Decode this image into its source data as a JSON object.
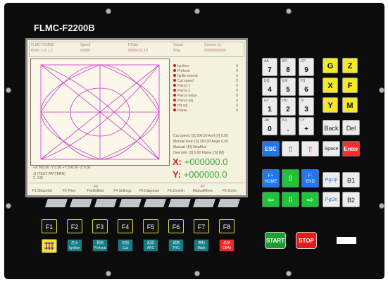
{
  "brand": "FLMC-F2200B",
  "screen": {
    "header": [
      {
        "title": "FLMC F2200B",
        "value": "Ratio: 1.3, 1.1"
      },
      {
        "title": "Speed",
        "value": "00000"
      },
      {
        "title": "F.Rate",
        "value": "50000.01.10"
      },
      {
        "title": "Status",
        "value": "Stop"
      },
      {
        "title": "Current no.",
        "value": "00000000000"
      }
    ],
    "params": [
      {
        "label": "Ignition",
        "value": "0"
      },
      {
        "label": "Preheat",
        "value": "0"
      },
      {
        "label": "Ignite extend",
        "value": "0"
      },
      {
        "label": "Cut speed",
        "value": "0"
      },
      {
        "label": "Pierce 1",
        "value": "0"
      },
      {
        "label": "Pierce 2",
        "value": "0"
      },
      {
        "label": "Pierce delay",
        "value": "0"
      },
      {
        "label": "Pierce adj",
        "value": "0"
      },
      {
        "label": "Hit adj",
        "value": "0"
      },
      {
        "label": "Flame",
        "value": "0"
      }
    ],
    "status_lines": [
      "Cut speed: [S] 300.00 Kerf [V] 0.00",
      "Manual feed: [S] 300.00 Angle 0.00",
      "Manual: [M] StepMov",
      "Override: [S] 5.00 Flame: [S] [M]"
    ],
    "coords": "+X:500.00    -Y:0.00    +Y:500.00    -Z:0.00",
    "program": [
      "1) (TEST PATTERN)",
      "2. 100"
    ],
    "x_label": "X:",
    "x_value": "+000000.0",
    "y_label": "Y:",
    "y_value": "+000000.0",
    "fbar": [
      {
        "top": "",
        "bottom": "F1 ShapeLib"
      },
      {
        "top": "",
        "bottom": "F2 Files"
      },
      {
        "top": "F3",
        "bottom": "PartEdition"
      },
      {
        "top": "",
        "bottom": "F4 Settings"
      },
      {
        "top": "",
        "bottom": "F5 Diagnose"
      },
      {
        "top": "",
        "bottom": "F6 ZoomIn"
      },
      {
        "top": "F7",
        "bottom": "ManualMove"
      },
      {
        "top": "",
        "bottom": "F8 Zoom"
      }
    ]
  },
  "fkeys": [
    "F1",
    "F2",
    "F3",
    "F4",
    "F5",
    "F6",
    "F7",
    "F8"
  ],
  "tkeys": [
    {
      "zh": "",
      "en": ""
    },
    {
      "zh": "左火",
      "en": "Ignition"
    },
    {
      "zh": "预热",
      "en": "Preheat"
    },
    {
      "zh": "切割",
      "en": "Cut"
    },
    {
      "zh": "起弧",
      "en": "ARC"
    },
    {
      "zh": "调高",
      "en": "THC"
    },
    {
      "zh": "喷粉",
      "en": "Mark"
    },
    {
      "zh": "总关",
      "en": "OffAll"
    }
  ],
  "numpad": [
    {
      "sub": "AA",
      "main": "7"
    },
    {
      "sub": "BO",
      "main": "8"
    },
    {
      "sub": "CP",
      "main": "9"
    },
    {
      "sub": "DQ",
      "main": "4"
    },
    {
      "sub": "ER",
      "main": "5"
    },
    {
      "sub": "FS",
      "main": "6"
    },
    {
      "sub": "GT",
      "main": "1"
    },
    {
      "sub": "HU",
      "main": "2"
    },
    {
      "sub": "IV",
      "main": "3"
    },
    {
      "sub": "JW",
      "main": "0"
    },
    {
      "sub": "KX",
      "main": "."
    },
    {
      "sub": "LY",
      "main": "+"
    }
  ],
  "letters": [
    "G",
    "Z",
    "X",
    "F",
    "Y",
    "M"
  ],
  "edit_keys": {
    "back": "Back",
    "del": "Del",
    "space": "Space",
    "enter": "Enter",
    "esc": "ESC"
  },
  "nav_keys": {
    "home": "F+\nHOME",
    "end": "F-\nEND",
    "pgup": "PgUp",
    "pgdn": "PgDn",
    "b1": "B1",
    "b2": "B2"
  },
  "start": "START",
  "stop": "STOP",
  "colors": {
    "panel": "#0c0c0d",
    "screen": "#f4f1dc",
    "pattern": "#cc33cc",
    "yellow": "#f4ea28",
    "blue": "#1f78f0",
    "green": "#20c43a",
    "red": "#ff2e2e",
    "teal": "#167c86"
  }
}
